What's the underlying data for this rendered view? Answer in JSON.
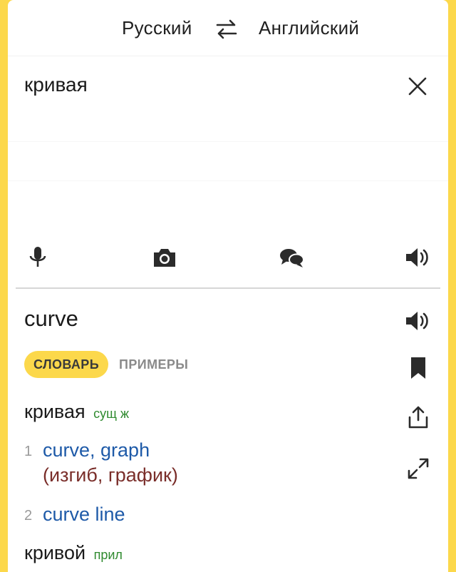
{
  "header": {
    "source_language": "Русский",
    "target_language": "Английский"
  },
  "input": {
    "text": "кривая"
  },
  "toolbar": {
    "icons": [
      "microphone-icon",
      "camera-icon",
      "chat-icon",
      "speaker-icon"
    ]
  },
  "result": {
    "translation": "curve",
    "tabs": {
      "dictionary": "СЛОВАРЬ",
      "examples": "ПРИМЕРЫ"
    },
    "entries": [
      {
        "word": "кривая",
        "pos": "сущ",
        "gender": "ж",
        "senses": [
          {
            "num": "1",
            "translation": "curve, graph",
            "note": "(изгиб, график)"
          },
          {
            "num": "2",
            "translation": "curve line"
          }
        ]
      },
      {
        "word": "кривой",
        "pos": "прил"
      }
    ]
  },
  "colors": {
    "accent": "#fcd84b",
    "link": "#1e5aa8",
    "pos": "#2f8a2f",
    "note": "#7a2e2a"
  }
}
